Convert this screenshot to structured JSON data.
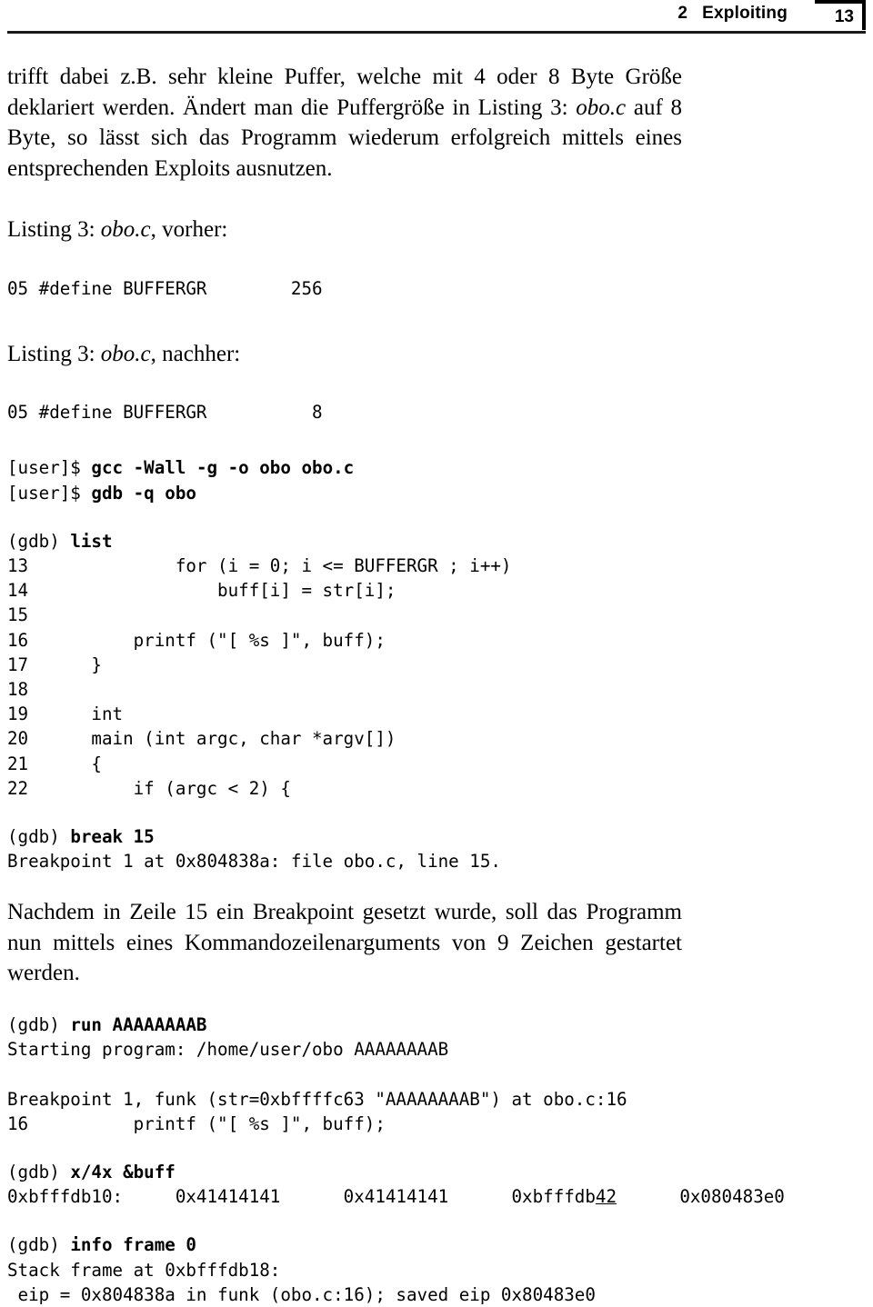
{
  "header": {
    "chapter_number": "2",
    "chapter_title": "Exploiting",
    "page_number": "13"
  },
  "body": {
    "paragraph_1_part1": "trifft dabei z.B. sehr kleine Puffer, welche mit 4 oder 8 Byte Größe deklariert werden. Ändert man die Puffergröße in Listing 3: ",
    "paragraph_1_italic": "obo.c",
    "paragraph_1_part2": " auf 8 Byte, so lässt sich das Programm wiederum erfolgreich mittels eines entsprechenden Exploits ausnutzen.",
    "caption_1_prefix": "Listing 3: ",
    "caption_1_italic": "obo.c",
    "caption_1_suffix": ", vorher:",
    "caption_2_prefix": "Listing 3: ",
    "caption_2_italic": "obo.c",
    "caption_2_suffix": ", nachher:",
    "paragraph_2": "Nachdem in Zeile 15 ein Breakpoint gesetzt wurde, soll das Programm nun mittels eines Kommandozeilenarguments von 9 Zeichen gestartet werden."
  },
  "code": {
    "listing_before": "05 #define BUFFERGR        256",
    "listing_after": "05 #define BUFFERGR          8",
    "shell_prompt_1": "[user]$ ",
    "shell_command_1": "gcc -Wall -g -o obo obo.c",
    "shell_prompt_2": "[user]$ ",
    "shell_command_2": "gdb -q obo",
    "gdb_prompt": "(gdb) ",
    "gdb_command_list": "list",
    "source_lines": [
      "13              for (i = 0; i <= BUFFERGR ; i++)",
      "14                  buff[i] = str[i];",
      "15",
      "16          printf (\"[ %s ]\", buff);",
      "17      }",
      "18",
      "19      int",
      "20      main (int argc, char *argv[])",
      "21      {",
      "22          if (argc < 2) {"
    ],
    "gdb_command_break": "break 15",
    "break_output": "Breakpoint 1 at 0x804838a: file obo.c, line 15.",
    "gdb_command_run": "run AAAAAAAAB",
    "run_output_1": "Starting program: /home/user/obo AAAAAAAAB",
    "run_output_2": "Breakpoint 1, funk (str=0xbffffc63 \"AAAAAAAAB\") at obo.c:16",
    "run_output_3": "16          printf (\"[ %s ]\", buff);",
    "gdb_command_x4x": "x/4x &buff",
    "x4x_output_prefix": "0xbfffdb10:     0x41414141      0x41414141      0xbfffdb",
    "x4x_output_underlined": "42",
    "x4x_output_suffix": "      0x080483e0",
    "gdb_command_info_frame": "info frame 0",
    "info_frame_output_1": "Stack frame at 0xbfffdb18:",
    "info_frame_output_2": " eip = 0x804838a in funk (obo.c:16); saved eip 0x80483e0"
  }
}
